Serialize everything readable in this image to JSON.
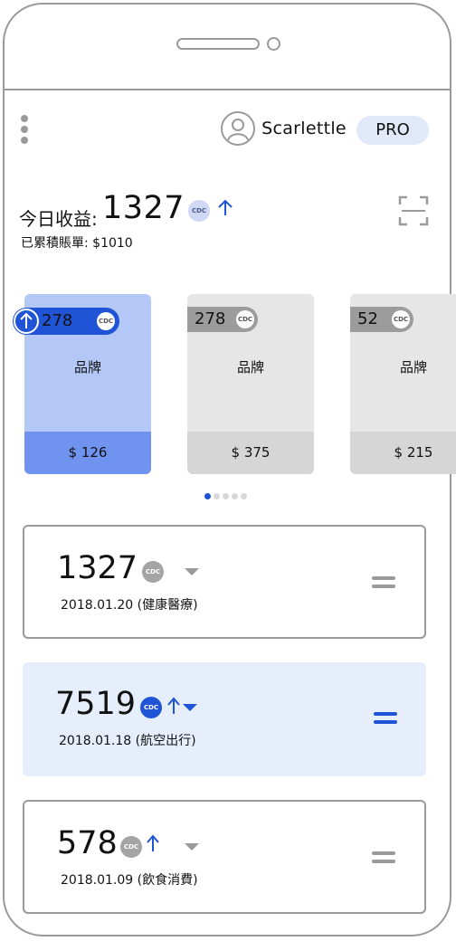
{
  "header": {
    "username": "Scarlettle",
    "badge": "PRO"
  },
  "summary": {
    "earnings_label": "今日收益:",
    "earnings_value": "1327",
    "currency": "CDC",
    "accumulated_label": "已累積賬單:",
    "accumulated_value": "$1010"
  },
  "cards": [
    {
      "count": "278",
      "brand": "品牌",
      "price": "$ 126",
      "active": true
    },
    {
      "count": "278",
      "brand": "品牌",
      "price": "$ 375",
      "active": false
    },
    {
      "count": "52",
      "brand": "品牌",
      "price": "$ 215",
      "active": false
    }
  ],
  "pager": {
    "total": 5,
    "current": 1
  },
  "transactions": [
    {
      "amount": "1327",
      "currency": "CDC",
      "date": "2018.01.20",
      "category": "(健康醫療)",
      "highlighted": false
    },
    {
      "amount": "7519",
      "currency": "CDC",
      "date": "2018.01.18",
      "category": "(航空出行)",
      "highlighted": true
    },
    {
      "amount": "578",
      "currency": "CDC",
      "date": "2018.01.09",
      "category": "(飲食消費)",
      "highlighted": false
    }
  ],
  "colors": {
    "accent": "#1f54d6",
    "card_active": "#b4c8f8",
    "card_active_footer": "#6f93ef",
    "card_inactive": "#e6e6e6",
    "highlight_row": "#e6edfb"
  }
}
